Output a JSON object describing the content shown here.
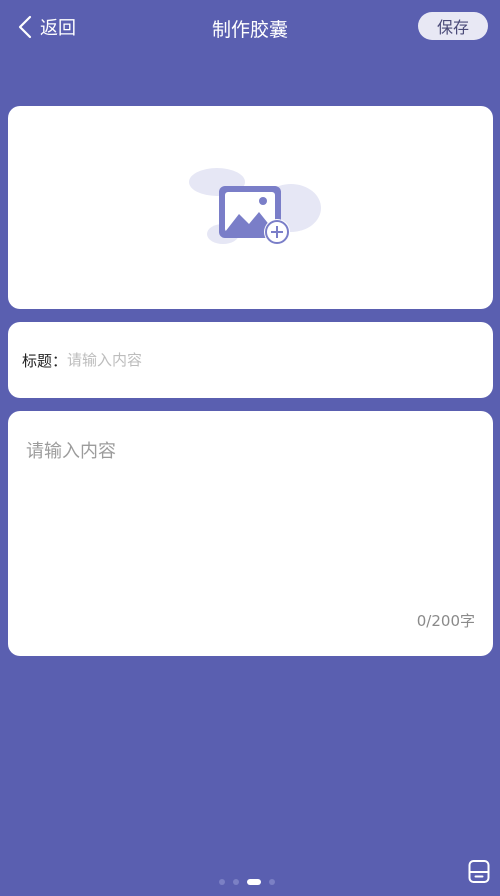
{
  "header": {
    "back_label": "返回",
    "title": "制作胶囊",
    "save_label": "保存"
  },
  "image_upload": {
    "icon": "add-image-icon"
  },
  "title_field": {
    "label": "标题：",
    "placeholder": "请输入内容",
    "value": ""
  },
  "content_field": {
    "placeholder": "请输入内容",
    "value": "",
    "counter": "0/200字"
  },
  "pager": {
    "count": 4,
    "active_index": 2
  },
  "colors": {
    "background": "#5a5fb0",
    "card": "#ffffff",
    "icon_accent": "#7a7ec8",
    "icon_light": "#e6e7f5"
  }
}
